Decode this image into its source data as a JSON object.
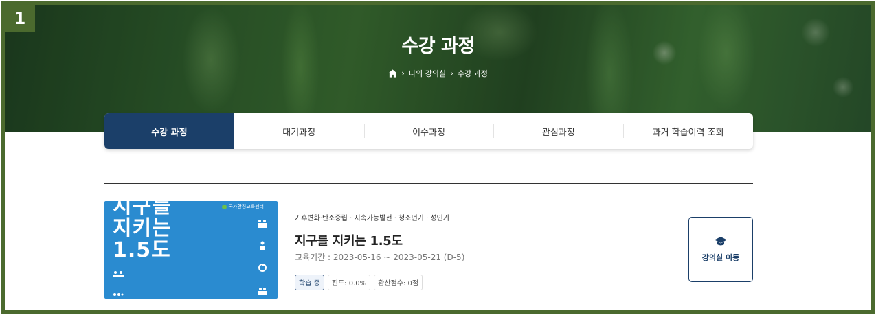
{
  "badge": "1",
  "hero": {
    "title": "수강 과정",
    "breadcrumb": [
      "나의 강의실",
      "수강 과정"
    ]
  },
  "tabs": [
    {
      "label": "수강 과정",
      "active": true
    },
    {
      "label": "대기과정",
      "active": false
    },
    {
      "label": "이수과정",
      "active": false
    },
    {
      "label": "관심과정",
      "active": false
    },
    {
      "label": "과거 학습이력 조회",
      "active": false
    }
  ],
  "course": {
    "thumbnail_text": [
      "지구를",
      "지키는",
      "1.5도"
    ],
    "thumbnail_logo": "국가환경교육센터",
    "categories": "기후변화·탄소중립 · 지속가능발전 · 청소년기 · 성인기",
    "title": "지구를 지키는 1.5도",
    "period": "교육기간 : 2023-05-16 ~ 2023-05-21 (D-5)",
    "status": "학습 중",
    "progress": "진도: 0.0%",
    "score": "환산점수: 0점",
    "enter_label": "강의실 이동"
  },
  "colors": {
    "primary": "#1b3f69",
    "frame": "#4b6a2e",
    "thumbnail": "#2a8bd0"
  }
}
